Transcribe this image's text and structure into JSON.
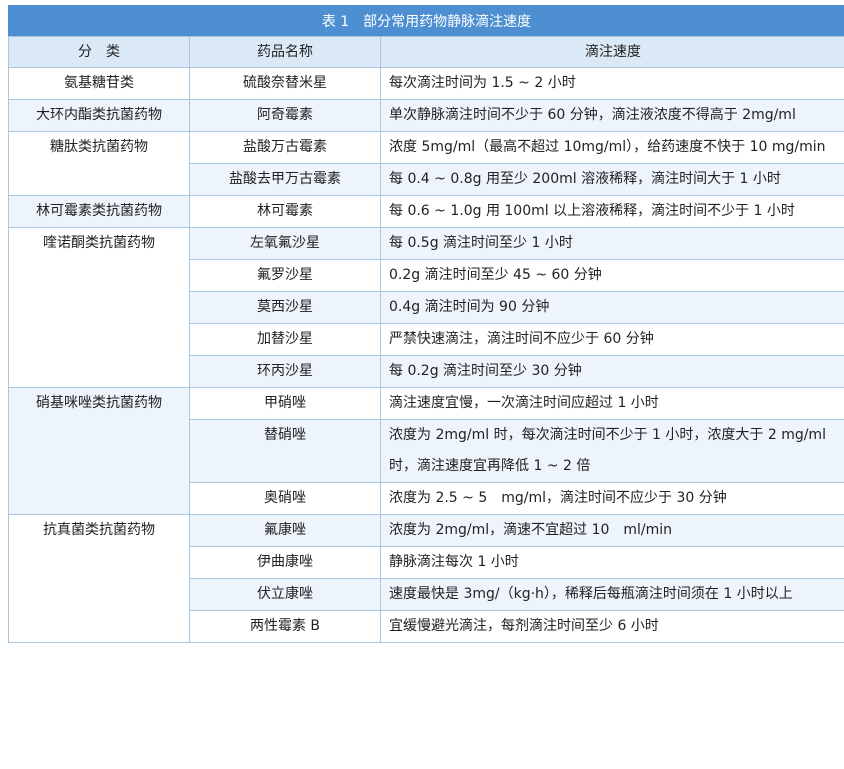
{
  "title": "表 1　部分常用药物静脉滴注速度",
  "headers": [
    "分　类",
    "药品名称",
    "滴注速度"
  ],
  "groups": [
    {
      "category": "氨基糖苷类",
      "rows": [
        {
          "drug": "硫酸奈替米星",
          "rate": "每次滴注时间为 1.5 ~ 2 小时"
        }
      ]
    },
    {
      "category": "大环内酯类抗菌药物",
      "rows": [
        {
          "drug": "阿奇霉素",
          "rate": "单次静脉滴注时间不少于 60 分钟，滴注液浓度不得高于 2mg/ml"
        }
      ]
    },
    {
      "category": "糖肽类抗菌药物",
      "rows": [
        {
          "drug": "盐酸万古霉素",
          "rate": "浓度 5mg/ml（最高不超过 10mg/ml），给药速度不快于 10 mg/min"
        },
        {
          "drug": "盐酸去甲万古霉素",
          "rate": "每 0.4 ~ 0.8g 用至少 200ml 溶液稀释，滴注时间大于 1 小时"
        }
      ]
    },
    {
      "category": "林可霉素类抗菌药物",
      "rows": [
        {
          "drug": "林可霉素",
          "rate": "每 0.6 ~ 1.0g 用 100ml 以上溶液稀释，滴注时间不少于 1 小时"
        }
      ]
    },
    {
      "category": "喹诺酮类抗菌药物",
      "rows": [
        {
          "drug": "左氧氟沙星",
          "rate": "每 0.5g 滴注时间至少 1 小时"
        },
        {
          "drug": "氟罗沙星",
          "rate": "0.2g 滴注时间至少 45 ~ 60 分钟"
        },
        {
          "drug": "莫西沙星",
          "rate": "0.4g 滴注时间为 90 分钟"
        },
        {
          "drug": "加替沙星",
          "rate": "严禁快速滴注，滴注时间不应少于 60 分钟"
        },
        {
          "drug": "环丙沙星",
          "rate": "每 0.2g 滴注时间至少 30 分钟"
        }
      ]
    },
    {
      "category": "硝基咪唑类抗菌药物",
      "rows": [
        {
          "drug": "甲硝唑",
          "rate": "滴注速度宜慢，一次滴注时间应超过 1 小时"
        },
        {
          "drug": "替硝唑",
          "rate": "浓度为 2mg/ml 时，每次滴注时间不少于 1 小时，浓度大于 2 mg/ml 时，滴注速度宜再降低 1 ~ 2 倍"
        },
        {
          "drug": "奥硝唑",
          "rate": "浓度为 2.5 ~ 5　mg/ml，滴注时间不应少于 30 分钟"
        }
      ]
    },
    {
      "category": "抗真菌类抗菌药物",
      "rows": [
        {
          "drug": "氟康唑",
          "rate": "浓度为 2mg/ml，滴速不宜超过 10　ml/min"
        },
        {
          "drug": "伊曲康唑",
          "rate": "静脉滴注每次 1 小时"
        },
        {
          "drug": "伏立康唑",
          "rate": "速度最快是 3mg/（kg·h），稀释后每瓶滴注时间须在 1 小时以上"
        },
        {
          "drug": "两性霉素 B",
          "rate": "宜缓慢避光滴注，每剂滴注时间至少 6 小时"
        }
      ]
    }
  ]
}
